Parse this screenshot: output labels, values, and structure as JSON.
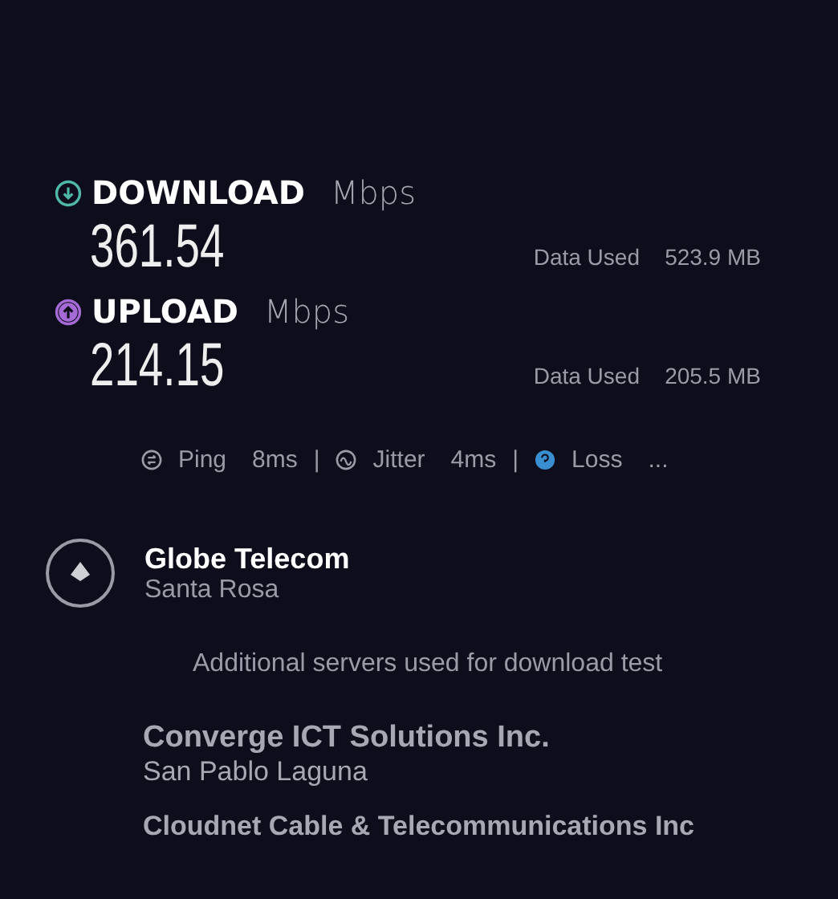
{
  "results": [
    {
      "kind": "download",
      "label": "DOWNLOAD",
      "unit": "Mbps",
      "value": "361.54",
      "data_label": "Data Used",
      "data_value": "523.9 MB"
    },
    {
      "kind": "upload",
      "label": "UPLOAD",
      "unit": "Mbps",
      "value": "214.15",
      "data_label": "Data Used",
      "data_value": "205.5 MB"
    }
  ],
  "metrics": [
    {
      "kind": "ping",
      "label": "Ping",
      "value": "8ms"
    },
    {
      "kind": "jitter",
      "separator": "|",
      "label": "Jitter",
      "value": "4ms"
    },
    {
      "kind": "loss",
      "separator": "|",
      "label": "Loss",
      "value": "..."
    }
  ],
  "server": {
    "name": "Globe Telecom",
    "location": "Santa Rosa"
  },
  "additional_note": "Additional servers used for download test",
  "additional_servers": [
    {
      "name": "Converge ICT Solutions Inc.",
      "location": "San Pablo Laguna"
    },
    {
      "name": "Cloudnet Cable & Telecommunications Inc"
    }
  ]
}
